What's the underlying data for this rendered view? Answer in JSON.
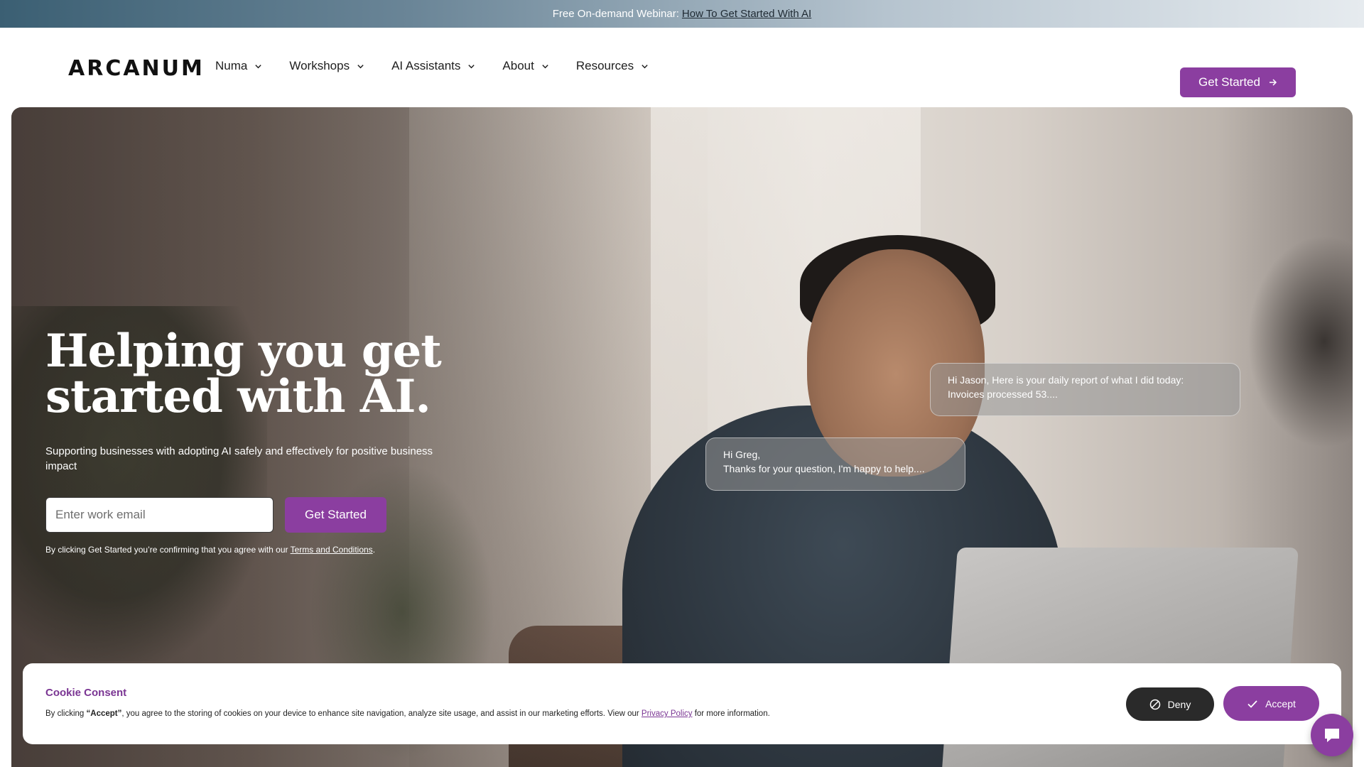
{
  "announcement": {
    "text": "Free On-demand Webinar:",
    "link": "How To Get Started With AI"
  },
  "header": {
    "logo": "ARCANUM",
    "menu": [
      {
        "label": "Numa",
        "icon": "chevron-down-icon"
      },
      {
        "label": "Workshops",
        "icon": "chevron-down-icon"
      },
      {
        "label": "AI Assistants",
        "icon": "chevron-down-icon"
      },
      {
        "label": "About",
        "icon": "chevron-down-icon"
      },
      {
        "label": "Resources",
        "icon": "chevron-down-icon"
      }
    ],
    "cta_label": "Get Started",
    "cta_icon": "arrow-right-icon"
  },
  "hero": {
    "title_line1": "Helping you get",
    "title_line2": "started with AI.",
    "subtitle": "Supporting businesses with adopting AI safely and effectively for positive business impact",
    "email_placeholder": "Enter work email",
    "cta_label": "Get Started",
    "terms_prefix": "By clicking Get Started you’re confirming that you agree with our ",
    "terms_link": "Terms and Conditions",
    "terms_suffix": ".",
    "bubble1_line1": "Hi Jason, Here is your daily report of what I did today:",
    "bubble1_line2": "Invoices processed 53....",
    "bubble2_line1": "Hi Greg,",
    "bubble2_line2": "Thanks for your question, I'm happy to help...."
  },
  "cookie": {
    "title": "Cookie Consent",
    "text_prefix": "By clicking ",
    "text_accept": "“Accept”",
    "text_body": ", you agree to the storing of cookies on your device to enhance site navigation, analyze site usage, and assist in our marketing efforts. View our ",
    "privacy_link": "Privacy Policy",
    "text_suffix": " for more information.",
    "deny_label": "Deny",
    "accept_label": "Accept"
  },
  "colors": {
    "brand": "#8b3ea0",
    "dark_button": "#2a2a2a"
  }
}
